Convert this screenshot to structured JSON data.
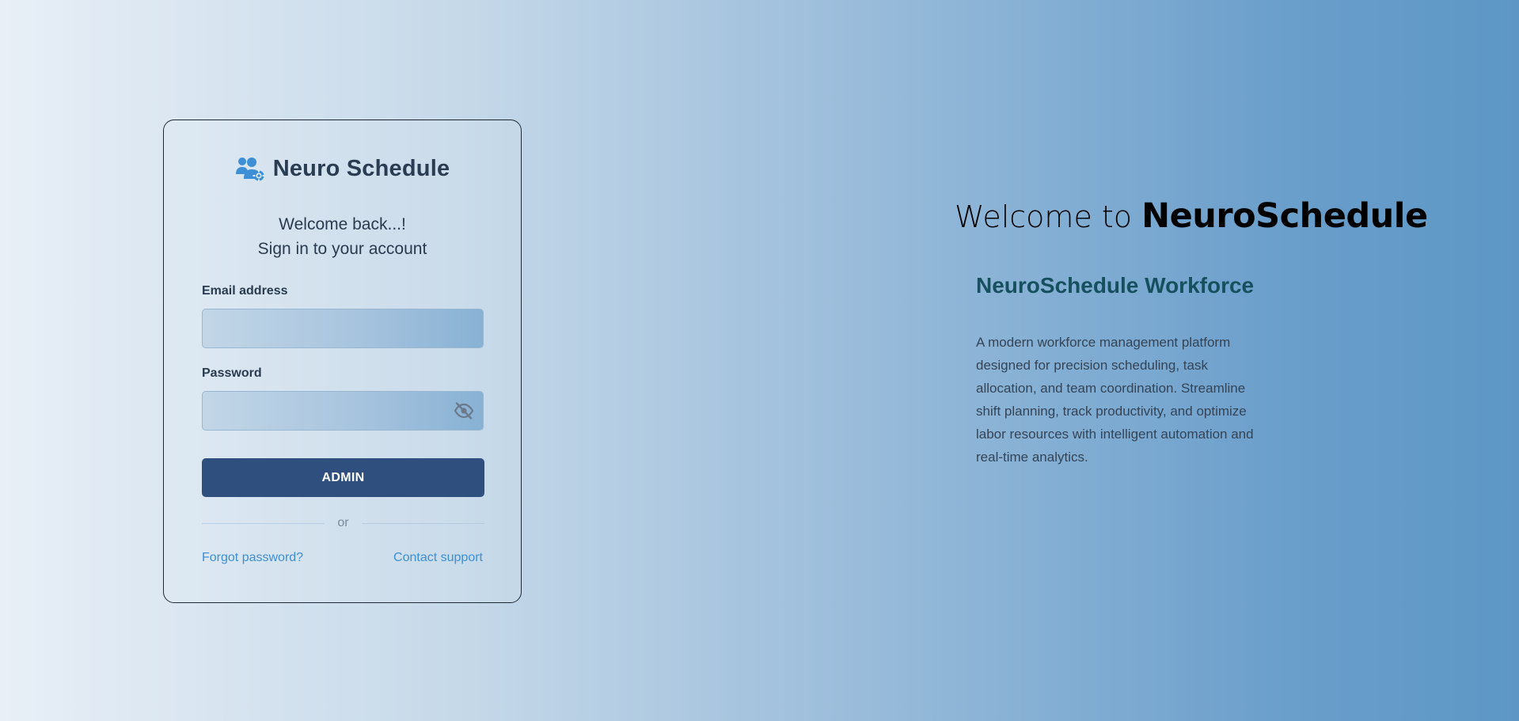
{
  "login": {
    "brand_title": "Neuro Schedule",
    "brand_icon": "users-gear-icon",
    "welcome_line1": "Welcome back...!",
    "welcome_line2": "Sign in to your account",
    "email_label": "Email address",
    "email_value": "",
    "password_label": "Password",
    "password_value": "",
    "password_toggle_icon": "eye-slash-icon",
    "submit_label": "ADMIN",
    "divider_text": "or",
    "forgot_password": "Forgot password?",
    "contact_support": "Contact support"
  },
  "hero": {
    "title_prefix": "Welcome to ",
    "title_brand": "NeuroSchedule",
    "subtitle": "NeuroSchedule Workforce",
    "description": "A modern workforce management platform designed for precision scheduling, task allocation, and team coordination. Streamline shift planning, track productivity, and optimize labor resources with intelligent automation and real-time analytics."
  },
  "colors": {
    "accent": "#3d8fd6",
    "button": "#2f4f7e",
    "subtitle": "#16505f"
  }
}
